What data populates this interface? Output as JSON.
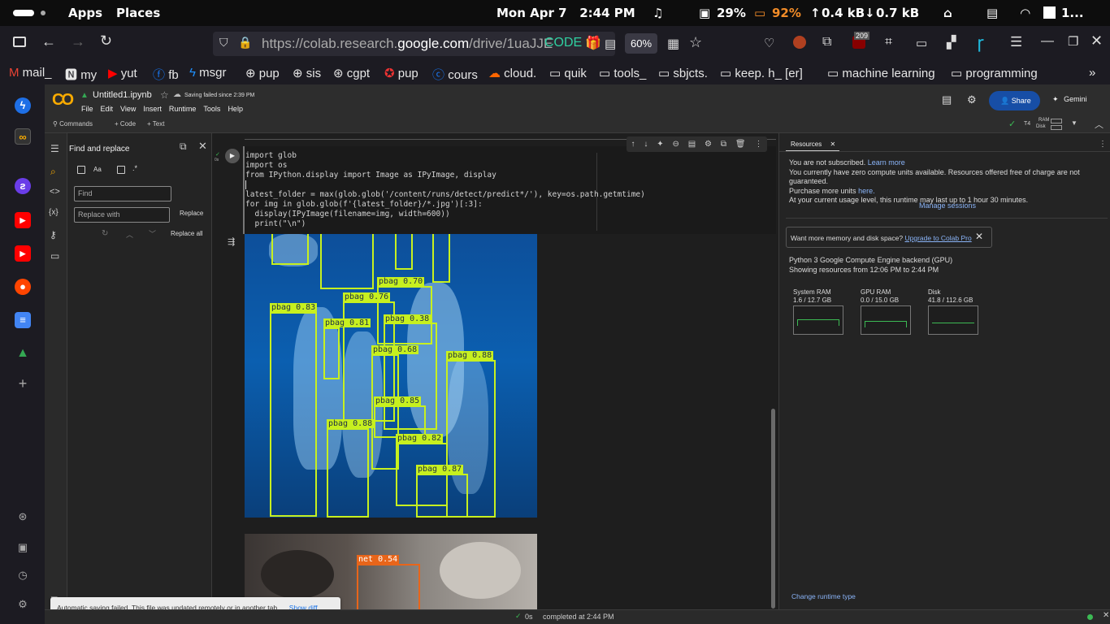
{
  "topbar": {
    "apps": "Apps",
    "places": "Places",
    "datetime": "Mon Apr 7   2:44 PM",
    "cpu": "29%",
    "battery": "92%",
    "upload": "0.4 kB",
    "download": "0.7 kB",
    "user": "1..."
  },
  "browser": {
    "url_prefix": "https://colab.research.",
    "url_domain": "google.com",
    "url_path": "/drive/1uaJJE",
    "code_label": "CODE",
    "zoom": "60%",
    "badge_count": "209",
    "bookmarks": [
      "mail_",
      "my",
      "yut",
      "fb",
      "msgr",
      "pup",
      "sis",
      "cgpt",
      "pup",
      "cours",
      "cloud.",
      "quik",
      "tools_",
      "sbjcts.",
      "keep. h_ [er]",
      "machine learning",
      "programming"
    ]
  },
  "colab": {
    "title": "Untitled1.ipynb",
    "saving_status": "Saving failed since 2:39 PM",
    "menu": [
      "File",
      "Edit",
      "View",
      "Insert",
      "Runtime",
      "Tools",
      "Help"
    ],
    "share": "Share",
    "gemini": "Gemini",
    "commands": "Commands",
    "add_code": "+ Code",
    "add_text": "+ Text",
    "runtime_type": "T4",
    "ram_label": "RAM",
    "disk_label": "Disk"
  },
  "find_panel": {
    "title": "Find and replace",
    "match_case": "Aa",
    "regex": ".*",
    "find_placeholder": "Find",
    "replace_placeholder": "Replace with",
    "replace": "Replace",
    "replace_all": "Replace all"
  },
  "code_cell": {
    "exec_status": "0s",
    "lines": [
      "import glob",
      "import os",
      "from IPython.display import Image as IPyImage, display",
      "",
      "latest_folder = max(glob.glob('/content/runs/detect/predict*/'), key=os.path.getmtime)",
      "for img in glob.glob(f'{latest_folder}/*.jpg')[:3]:",
      "  display(IPyImage(filename=img, width=600))",
      "  print(\"\\n\")"
    ]
  },
  "detections": {
    "image1": [
      "pbag 0.70",
      "pbag 0.83",
      "pbag 0.76",
      "pbag 0.81",
      "pbag 0.38",
      "pbag 0.68",
      "pbag 0.88",
      "pbag 0.85",
      "pbag 0.88",
      "pbag 0.82",
      "pbag 0.87"
    ],
    "image2": [
      "net 0.54"
    ]
  },
  "resources": {
    "tab": "Resources",
    "not_subscribed": "You are not subscribed.",
    "learn_more": "Learn more",
    "units_text": "You currently have zero compute units available. Resources offered free of charge are not guaranteed.",
    "purchase": "Purchase more units",
    "here": "here.",
    "usage_level": "At your current usage level, this runtime may last up to 1 hour 30 minutes.",
    "manage_sessions": "Manage sessions",
    "memory_prompt": "Want more memory and disk space?",
    "upgrade": "Upgrade to Colab Pro",
    "backend": "Python 3 Google Compute Engine backend (GPU)",
    "showing": "Showing resources from 12:06 PM to 2:44 PM",
    "system_ram_label": "System RAM",
    "system_ram_value": "1.6 / 12.7 GB",
    "gpu_ram_label": "GPU RAM",
    "gpu_ram_value": "0.0 / 15.0 GB",
    "disk_label": "Disk",
    "disk_value": "41.8 / 112.6 GB",
    "change_runtime": "Change runtime type"
  },
  "toast": {
    "message": "Automatic saving failed. This file was updated remotely or in another tab.",
    "action": "Show diff"
  },
  "status": {
    "time": "0s",
    "completed": "completed at 2:44 PM"
  },
  "colors": {
    "accent": "#1a73e8",
    "detect_box": "#c7f01f",
    "net_box": "#e8651a",
    "battery": "#f28c28"
  }
}
